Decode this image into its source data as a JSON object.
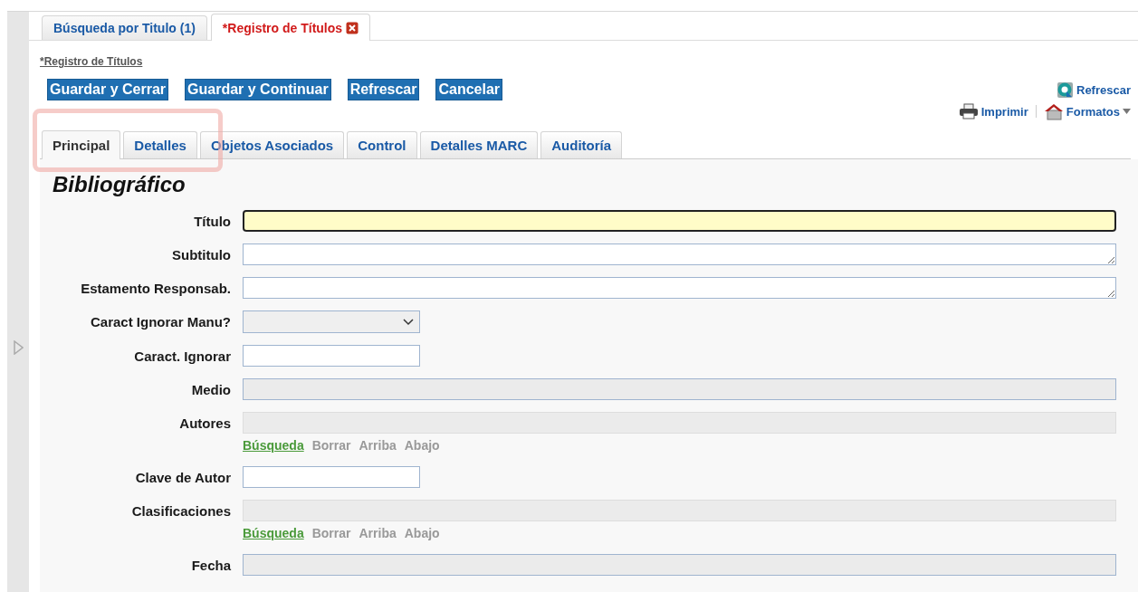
{
  "outer_tabs": [
    {
      "label": "Búsqueda por Titulo (1)",
      "selected": false,
      "closable": false
    },
    {
      "label": "*Registro de Títulos",
      "selected": true,
      "closable": true
    }
  ],
  "breadcrumb": "*Registro de Títulos",
  "buttons": [
    "Guardar y Cerrar",
    "Guardar y Continuar",
    "Refrescar",
    "Cancelar"
  ],
  "right_actions": {
    "refresh": "Refrescar",
    "print": "Imprimir",
    "formats": "Formatos"
  },
  "tabs": [
    {
      "label": "Principal",
      "selected": true
    },
    {
      "label": "Detalles",
      "selected": false
    },
    {
      "label": "Objetos Asociados",
      "selected": false
    },
    {
      "label": "Control",
      "selected": false
    },
    {
      "label": "Detalles MARC",
      "selected": false
    },
    {
      "label": "Auditoría",
      "selected": false
    }
  ],
  "section_title": "Bibliográfico",
  "fields": [
    {
      "label": "Título",
      "kind": "text",
      "focused": true
    },
    {
      "label": "Subtitulo",
      "kind": "textarea",
      "focused": false
    },
    {
      "label": "Estamento Responsab.",
      "kind": "textarea",
      "focused": false
    },
    {
      "label": "Caract Ignorar Manu?",
      "kind": "select",
      "focused": false
    },
    {
      "label": "Caract. Ignorar",
      "kind": "short",
      "focused": false
    },
    {
      "label": "Medio",
      "kind": "readonly",
      "focused": false
    },
    {
      "label": "Autores",
      "kind": "lookup",
      "focused": false,
      "actions": [
        {
          "label": "Búsqueda",
          "disabled": false
        },
        {
          "label": "Borrar",
          "disabled": true
        },
        {
          "label": "Arriba",
          "disabled": true
        },
        {
          "label": "Abajo",
          "disabled": true
        }
      ]
    },
    {
      "label": "Clave de Autor",
      "kind": "short",
      "focused": false
    },
    {
      "label": "Clasificaciones",
      "kind": "lookup",
      "focused": false,
      "actions": [
        {
          "label": "Búsqueda",
          "disabled": false
        },
        {
          "label": "Borrar",
          "disabled": true
        },
        {
          "label": "Arriba",
          "disabled": true
        },
        {
          "label": "Abajo",
          "disabled": true
        }
      ]
    },
    {
      "label": "Fecha",
      "kind": "readonly",
      "focused": false
    }
  ]
}
